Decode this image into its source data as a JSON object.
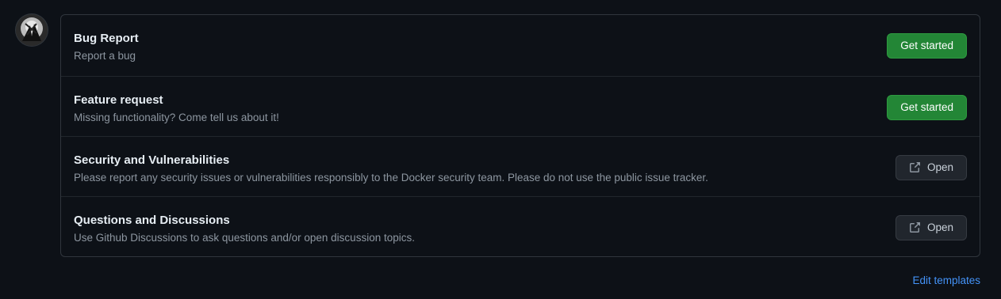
{
  "templates": [
    {
      "title": "Bug Report",
      "description": "Report a bug",
      "button": "Get started",
      "button_type": "primary"
    },
    {
      "title": "Feature request",
      "description": "Missing functionality? Come tell us about it!",
      "button": "Get started",
      "button_type": "primary"
    },
    {
      "title": "Security and Vulnerabilities",
      "description": "Please report any security issues or vulnerabilities responsibly to the Docker security team. Please do not use the public issue tracker.",
      "button": "Open",
      "button_type": "external",
      "button_icon": "link-external-icon"
    },
    {
      "title": "Questions and Discussions",
      "description": "Use Github Discussions to ask questions and/or open discussion topics.",
      "button": "Open",
      "button_type": "external",
      "button_icon": "link-external-icon"
    }
  ],
  "footer": {
    "edit_templates": "Edit templates"
  },
  "colors": {
    "background": "#0d1117",
    "primary_button": "#238636",
    "link": "#4493f8",
    "border": "#30363d"
  }
}
